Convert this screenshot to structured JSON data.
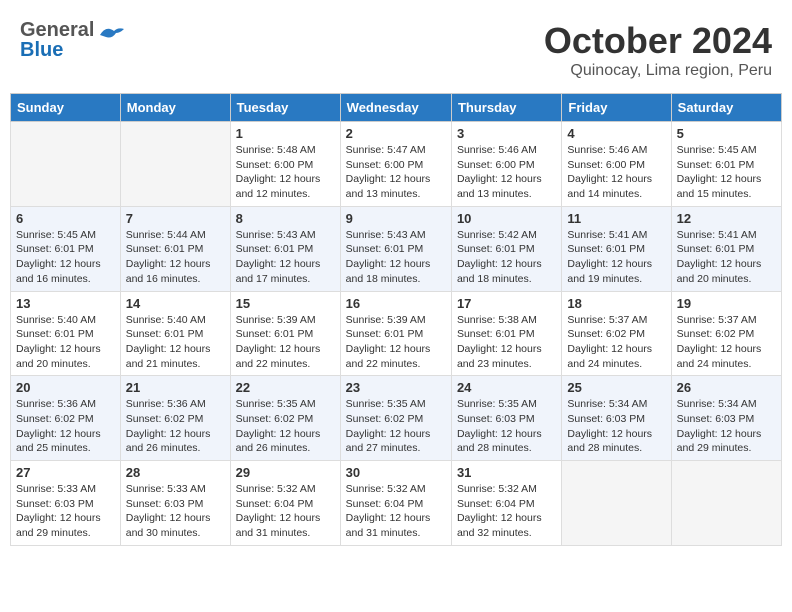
{
  "header": {
    "logo_general": "General",
    "logo_blue": "Blue",
    "month_title": "October 2024",
    "subtitle": "Quinocay, Lima region, Peru"
  },
  "calendar": {
    "weekdays": [
      "Sunday",
      "Monday",
      "Tuesday",
      "Wednesday",
      "Thursday",
      "Friday",
      "Saturday"
    ],
    "weeks": [
      [
        {
          "day": "",
          "info": ""
        },
        {
          "day": "",
          "info": ""
        },
        {
          "day": "1",
          "info": "Sunrise: 5:48 AM\nSunset: 6:00 PM\nDaylight: 12 hours\nand 12 minutes."
        },
        {
          "day": "2",
          "info": "Sunrise: 5:47 AM\nSunset: 6:00 PM\nDaylight: 12 hours\nand 13 minutes."
        },
        {
          "day": "3",
          "info": "Sunrise: 5:46 AM\nSunset: 6:00 PM\nDaylight: 12 hours\nand 13 minutes."
        },
        {
          "day": "4",
          "info": "Sunrise: 5:46 AM\nSunset: 6:00 PM\nDaylight: 12 hours\nand 14 minutes."
        },
        {
          "day": "5",
          "info": "Sunrise: 5:45 AM\nSunset: 6:01 PM\nDaylight: 12 hours\nand 15 minutes."
        }
      ],
      [
        {
          "day": "6",
          "info": "Sunrise: 5:45 AM\nSunset: 6:01 PM\nDaylight: 12 hours\nand 16 minutes."
        },
        {
          "day": "7",
          "info": "Sunrise: 5:44 AM\nSunset: 6:01 PM\nDaylight: 12 hours\nand 16 minutes."
        },
        {
          "day": "8",
          "info": "Sunrise: 5:43 AM\nSunset: 6:01 PM\nDaylight: 12 hours\nand 17 minutes."
        },
        {
          "day": "9",
          "info": "Sunrise: 5:43 AM\nSunset: 6:01 PM\nDaylight: 12 hours\nand 18 minutes."
        },
        {
          "day": "10",
          "info": "Sunrise: 5:42 AM\nSunset: 6:01 PM\nDaylight: 12 hours\nand 18 minutes."
        },
        {
          "day": "11",
          "info": "Sunrise: 5:41 AM\nSunset: 6:01 PM\nDaylight: 12 hours\nand 19 minutes."
        },
        {
          "day": "12",
          "info": "Sunrise: 5:41 AM\nSunset: 6:01 PM\nDaylight: 12 hours\nand 20 minutes."
        }
      ],
      [
        {
          "day": "13",
          "info": "Sunrise: 5:40 AM\nSunset: 6:01 PM\nDaylight: 12 hours\nand 20 minutes."
        },
        {
          "day": "14",
          "info": "Sunrise: 5:40 AM\nSunset: 6:01 PM\nDaylight: 12 hours\nand 21 minutes."
        },
        {
          "day": "15",
          "info": "Sunrise: 5:39 AM\nSunset: 6:01 PM\nDaylight: 12 hours\nand 22 minutes."
        },
        {
          "day": "16",
          "info": "Sunrise: 5:39 AM\nSunset: 6:01 PM\nDaylight: 12 hours\nand 22 minutes."
        },
        {
          "day": "17",
          "info": "Sunrise: 5:38 AM\nSunset: 6:01 PM\nDaylight: 12 hours\nand 23 minutes."
        },
        {
          "day": "18",
          "info": "Sunrise: 5:37 AM\nSunset: 6:02 PM\nDaylight: 12 hours\nand 24 minutes."
        },
        {
          "day": "19",
          "info": "Sunrise: 5:37 AM\nSunset: 6:02 PM\nDaylight: 12 hours\nand 24 minutes."
        }
      ],
      [
        {
          "day": "20",
          "info": "Sunrise: 5:36 AM\nSunset: 6:02 PM\nDaylight: 12 hours\nand 25 minutes."
        },
        {
          "day": "21",
          "info": "Sunrise: 5:36 AM\nSunset: 6:02 PM\nDaylight: 12 hours\nand 26 minutes."
        },
        {
          "day": "22",
          "info": "Sunrise: 5:35 AM\nSunset: 6:02 PM\nDaylight: 12 hours\nand 26 minutes."
        },
        {
          "day": "23",
          "info": "Sunrise: 5:35 AM\nSunset: 6:02 PM\nDaylight: 12 hours\nand 27 minutes."
        },
        {
          "day": "24",
          "info": "Sunrise: 5:35 AM\nSunset: 6:03 PM\nDaylight: 12 hours\nand 28 minutes."
        },
        {
          "day": "25",
          "info": "Sunrise: 5:34 AM\nSunset: 6:03 PM\nDaylight: 12 hours\nand 28 minutes."
        },
        {
          "day": "26",
          "info": "Sunrise: 5:34 AM\nSunset: 6:03 PM\nDaylight: 12 hours\nand 29 minutes."
        }
      ],
      [
        {
          "day": "27",
          "info": "Sunrise: 5:33 AM\nSunset: 6:03 PM\nDaylight: 12 hours\nand 29 minutes."
        },
        {
          "day": "28",
          "info": "Sunrise: 5:33 AM\nSunset: 6:03 PM\nDaylight: 12 hours\nand 30 minutes."
        },
        {
          "day": "29",
          "info": "Sunrise: 5:32 AM\nSunset: 6:04 PM\nDaylight: 12 hours\nand 31 minutes."
        },
        {
          "day": "30",
          "info": "Sunrise: 5:32 AM\nSunset: 6:04 PM\nDaylight: 12 hours\nand 31 minutes."
        },
        {
          "day": "31",
          "info": "Sunrise: 5:32 AM\nSunset: 6:04 PM\nDaylight: 12 hours\nand 32 minutes."
        },
        {
          "day": "",
          "info": ""
        },
        {
          "day": "",
          "info": ""
        }
      ]
    ]
  }
}
